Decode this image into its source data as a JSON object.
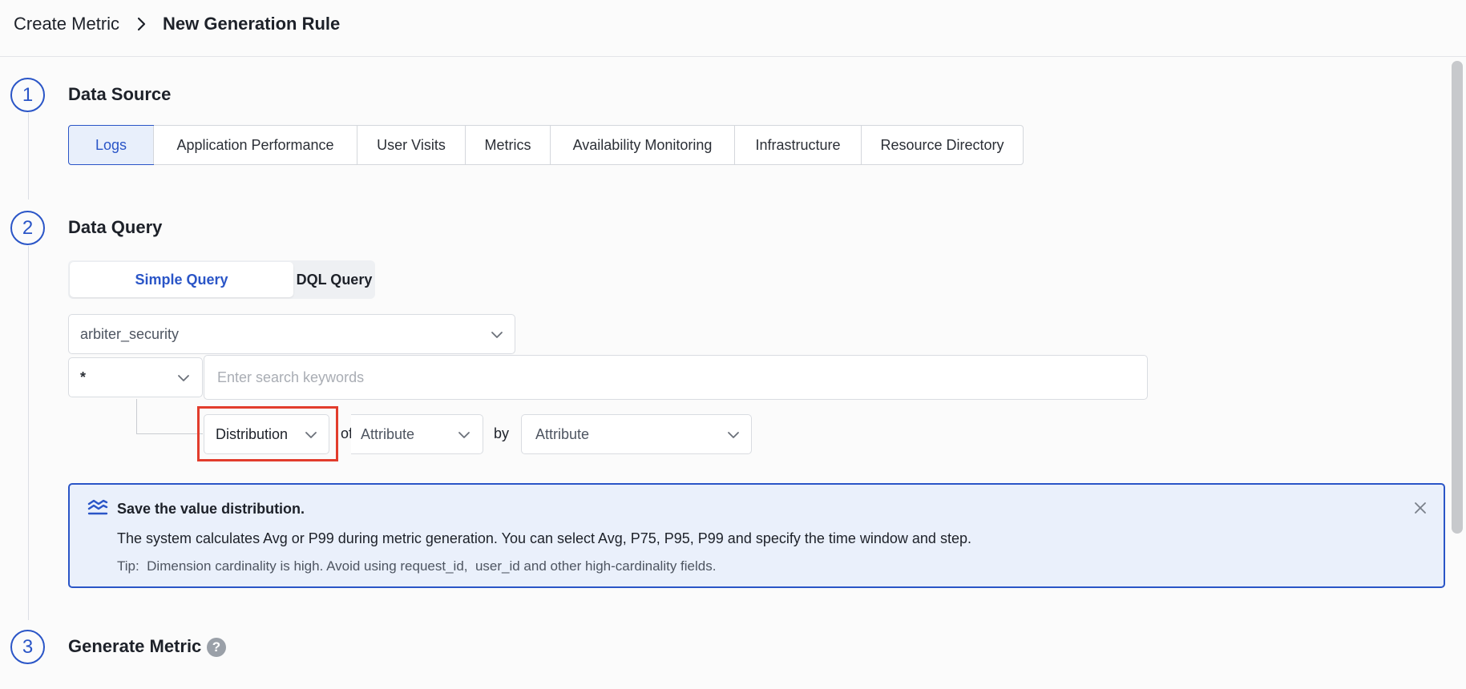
{
  "breadcrumb": {
    "parent": "Create Metric",
    "current": "New Generation Rule"
  },
  "steps": [
    {
      "number": "1",
      "title": "Data Source"
    },
    {
      "number": "2",
      "title": "Data Query"
    },
    {
      "number": "3",
      "title": "Generate Metric"
    }
  ],
  "data_source": {
    "active": "Logs",
    "options": [
      "Logs",
      "Application Performance",
      "User Visits",
      "Metrics",
      "Availability Monitoring",
      "Infrastructure",
      "Resource Directory"
    ]
  },
  "query_tabs": {
    "simple": "Simple Query",
    "dql": "DQL Query",
    "active": "Simple Query"
  },
  "query": {
    "source_select": "arbiter_security",
    "field_select": "*",
    "search_placeholder": "Enter search keywords",
    "aggregation_select": "Distribution",
    "of_label": "of",
    "of_attribute": "Attribute",
    "by_label": "by",
    "by_attribute": "Attribute"
  },
  "info_banner": {
    "title": "Save the value distribution.",
    "body": "The system calculates Avg or P99 during metric generation. You can select Avg, P75, P95, P99 and specify the time window and step.",
    "tip": "Tip:  Dimension cardinality is high. Avoid using request_id,  user_id and other high-cardinality fields."
  },
  "help_glyph": "?",
  "colors": {
    "accent": "#2a55c7",
    "highlight": "#e23c2c",
    "info_bg": "#eaf0fb"
  }
}
